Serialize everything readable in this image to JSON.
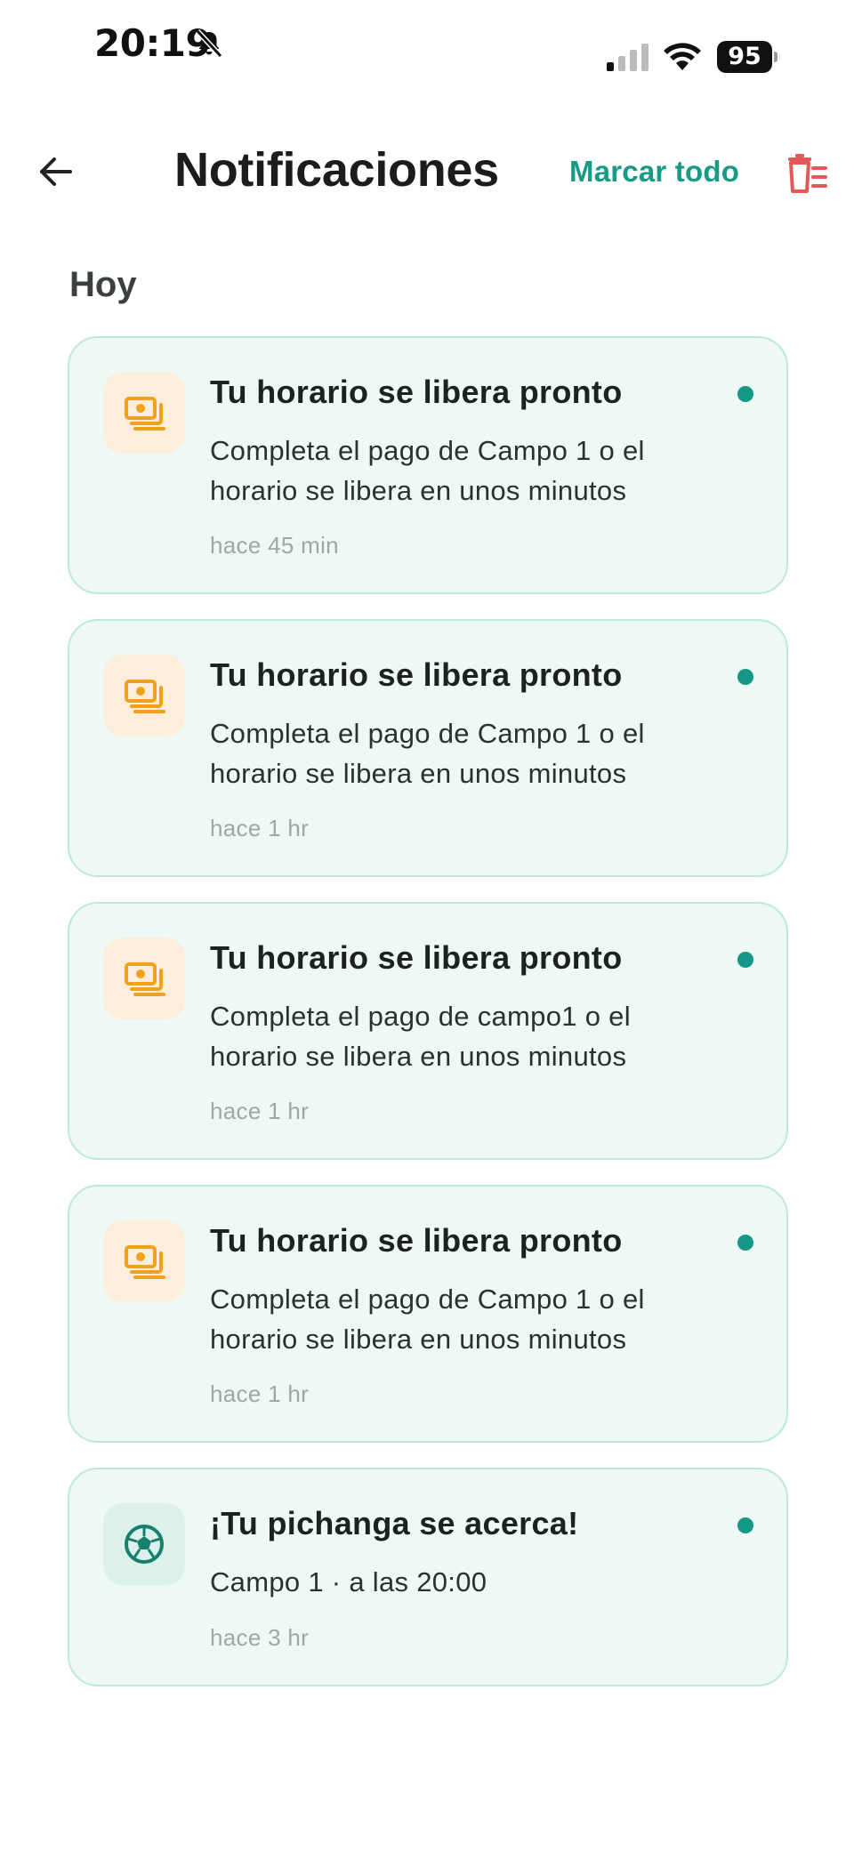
{
  "status_bar": {
    "time": "20:19",
    "battery": "95",
    "icons": [
      "bell-slash-icon",
      "cellular-signal-icon",
      "wifi-icon",
      "battery-icon"
    ]
  },
  "header": {
    "title": "Notificaciones",
    "mark_all_label": "Marcar todo",
    "back_icon": "arrow-left-icon",
    "delete_icon": "trash-list-icon"
  },
  "section": {
    "title": "Hoy"
  },
  "notifications": [
    {
      "icon": "money-icon",
      "title": "Tu horario se libera pronto",
      "body": "Completa el pago de Campo 1 o el horario se libera en unos minutos",
      "time": "hace 45 min",
      "unread": true
    },
    {
      "icon": "money-icon",
      "title": "Tu horario se libera pronto",
      "body": "Completa el pago de Campo 1 o el horario se libera en unos minutos",
      "time": "hace 1 hr",
      "unread": true
    },
    {
      "icon": "money-icon",
      "title": "Tu horario se libera pronto",
      "body": "Completa el pago de campo1 o el horario se libera en unos minutos",
      "time": "hace 1 hr",
      "unread": true
    },
    {
      "icon": "money-icon",
      "title": "Tu horario se libera pronto",
      "body": "Completa el pago de Campo 1 o el horario se libera en unos minutos",
      "time": "hace 1 hr",
      "unread": true
    },
    {
      "icon": "soccer-ball-icon",
      "title": "¡Tu pichanga se acerca!",
      "body": "Campo 1 · a las 20:00",
      "time": "hace 3 hr",
      "unread": true
    }
  ],
  "colors": {
    "accent": "#179a86",
    "danger": "#e05a5a",
    "money_icon": "#f0a21c",
    "card_bg": "#eef9f6",
    "card_border": "#bfe8dc"
  }
}
